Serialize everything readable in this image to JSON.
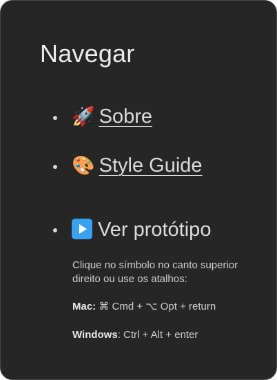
{
  "panel": {
    "title": "Navegar",
    "items": [
      {
        "emoji": "🚀",
        "label": "Sobre"
      },
      {
        "emoji": "🎨",
        "label": "Style Guide"
      },
      {
        "emoji": "",
        "label": "Ver protótipo"
      }
    ],
    "prototype_help": {
      "intro": "Clique no símbolo no canto superior direito ou use os atalhos:",
      "mac_label": "Mac:",
      "mac_shortcut": "⌘ Cmd + ⌥ Opt + return",
      "windows_label": "Windows",
      "windows_shortcut": ": Ctrl + Alt + enter"
    }
  }
}
